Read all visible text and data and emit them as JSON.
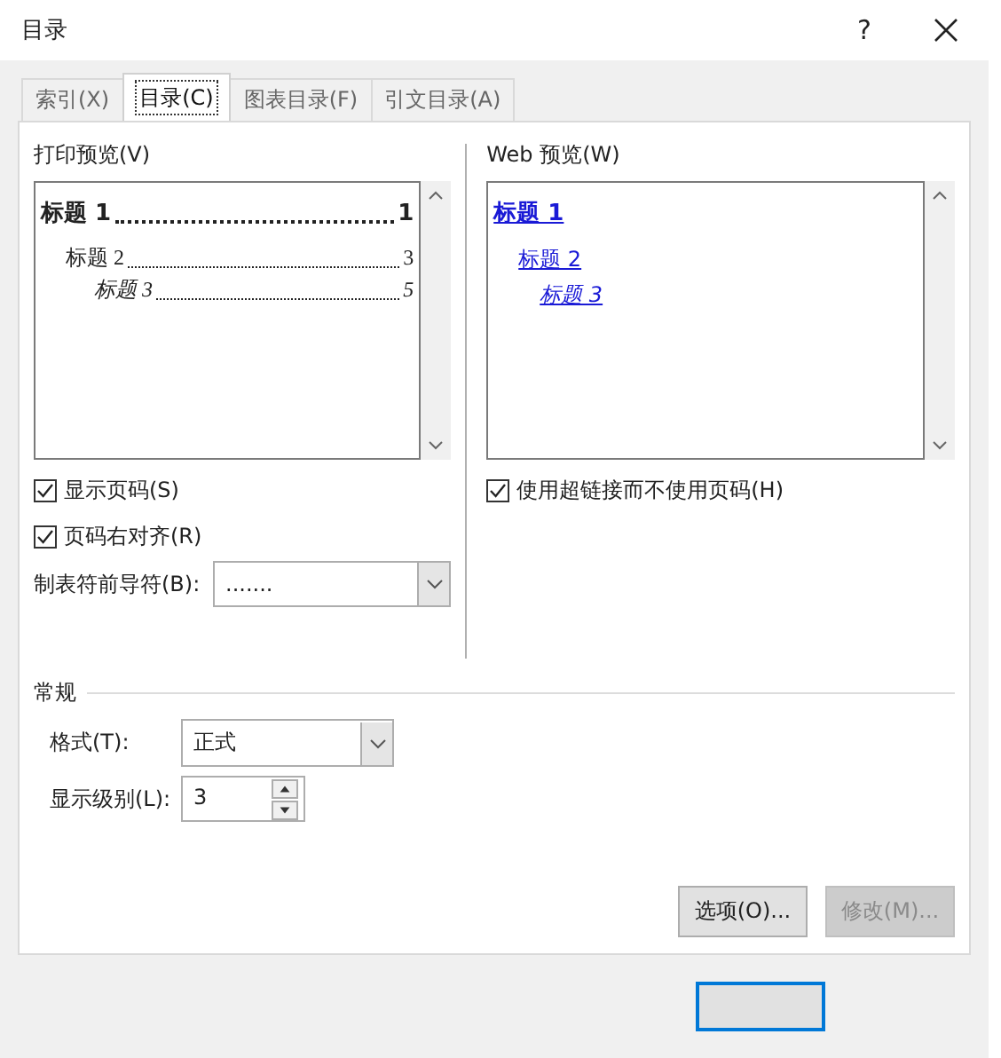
{
  "window": {
    "title": "目录",
    "help": "?"
  },
  "tabs": [
    {
      "label": "索引(X)",
      "selected": false
    },
    {
      "label": "目录(C)",
      "selected": true
    },
    {
      "label": "图表目录(F)",
      "selected": false
    },
    {
      "label": "引文目录(A)",
      "selected": false
    }
  ],
  "print_preview": {
    "label": "打印预览(V)",
    "entries": [
      {
        "heading": "标题 1",
        "page": "1",
        "children": [
          {
            "heading": "标题 2",
            "page": "3",
            "children": [
              {
                "heading": "标题 3",
                "page": "5"
              }
            ]
          }
        ]
      }
    ],
    "options": [
      {
        "label": "显示页码(S)",
        "checked": true
      },
      {
        "label": "页码右对齐(R)",
        "checked": true
      }
    ],
    "leader": {
      "label": "制表符前导符(B):",
      "value": "......."
    }
  },
  "web_preview": {
    "label": "Web 预览(W)",
    "entries": [
      {
        "heading": "标题 1",
        "children": [
          {
            "heading": "标题 2",
            "children": [
              {
                "heading": "标题 3"
              }
            ]
          }
        ]
      }
    ],
    "options": [
      {
        "label": "使用超链接而不使用页码(H)",
        "checked": true
      }
    ]
  },
  "general": {
    "title": "常规",
    "format": {
      "label": "格式(T):",
      "value": "正式"
    },
    "levels": {
      "label": "显示级别(L):",
      "value": "3"
    }
  },
  "buttons": [
    {
      "label": "选项(O)...",
      "disabled": false
    },
    {
      "label": "修改(M)...",
      "disabled": true
    }
  ]
}
